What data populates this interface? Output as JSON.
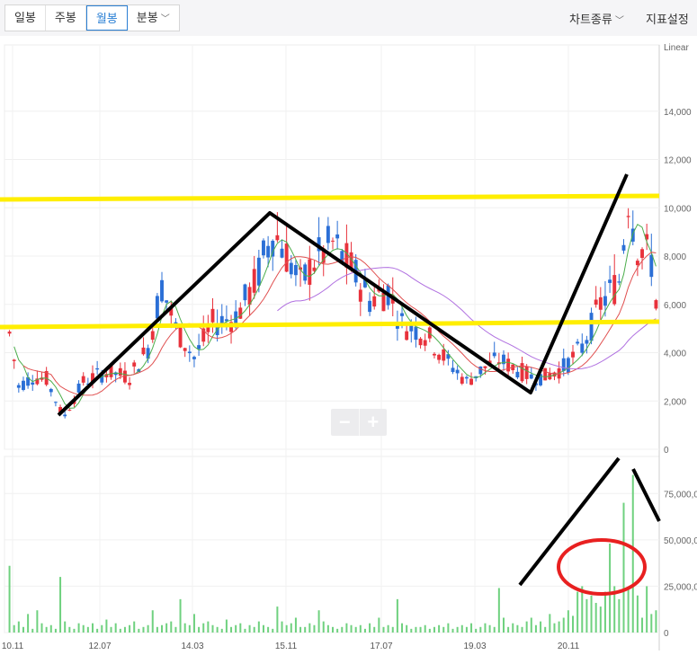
{
  "toolbar": {
    "tabs": [
      {
        "label": "일봉",
        "active": false
      },
      {
        "label": "주봉",
        "active": false
      },
      {
        "label": "월봉",
        "active": true
      },
      {
        "label": "분봉",
        "active": false
      }
    ],
    "chart_type_menu": "차트종류",
    "indicator_menu": "지표설정"
  },
  "zoom": {
    "minus": "−",
    "plus": "+"
  },
  "colors": {
    "up": "#e8323c",
    "down": "#2b6fd6",
    "volume": "#6fd17f",
    "support_line": "#ffee00",
    "annotation": "#000000",
    "circle": "#e82020",
    "ma_short": "#4cae4c",
    "ma_mid": "#e05050",
    "ma_long": "#b070e0"
  },
  "chart_data": {
    "type": "candlestick",
    "scale": "Linear",
    "y_ticks": [
      "14,000",
      "12,000",
      "10,000",
      "8,000",
      "6,000",
      "4,000",
      "2,000",
      "0"
    ],
    "y_range": [
      0,
      16000
    ],
    "volume_ticks": [
      "75,000,0",
      "50,000,0",
      "25,000,0",
      "0"
    ],
    "volume_range": [
      0,
      95000
    ],
    "x_labels": [
      "10.11",
      "12.07",
      "14.03",
      "15.11",
      "17.07",
      "19.03",
      "20.11"
    ],
    "price_anchors": [
      [
        0,
        4800
      ],
      [
        2,
        2600
      ],
      [
        5,
        3000
      ],
      [
        8,
        2900
      ],
      [
        11,
        1600
      ],
      [
        12,
        1400
      ],
      [
        16,
        2800
      ],
      [
        21,
        3200
      ],
      [
        26,
        3000
      ],
      [
        30,
        4200
      ],
      [
        33,
        6800
      ],
      [
        36,
        5000
      ],
      [
        40,
        3800
      ],
      [
        44,
        5200
      ],
      [
        49,
        5500
      ],
      [
        53,
        6800
      ],
      [
        57,
        9000
      ],
      [
        59,
        8500
      ],
      [
        63,
        6800
      ],
      [
        66,
        7800
      ],
      [
        70,
        8500
      ],
      [
        74,
        7500
      ],
      [
        78,
        6200
      ],
      [
        82,
        6600
      ],
      [
        85,
        5200
      ],
      [
        90,
        4800
      ],
      [
        95,
        3600
      ],
      [
        99,
        2800
      ],
      [
        103,
        3400
      ],
      [
        106,
        3700
      ],
      [
        109,
        3400
      ],
      [
        113,
        3000
      ],
      [
        116,
        3000
      ],
      [
        120,
        3400
      ],
      [
        124,
        4200
      ],
      [
        128,
        6000
      ],
      [
        132,
        7000
      ],
      [
        134,
        10500
      ],
      [
        136,
        8500
      ],
      [
        139,
        7800
      ],
      [
        140,
        6200
      ]
    ],
    "volume_values": [
      36,
      4,
      6,
      3,
      10,
      2,
      12,
      5,
      3,
      4,
      2,
      30,
      6,
      3,
      2,
      5,
      4,
      3,
      5,
      2,
      4,
      7,
      3,
      5,
      2,
      3,
      4,
      6,
      2,
      3,
      4,
      12,
      3,
      4,
      5,
      6,
      3,
      18,
      5,
      4,
      10,
      3,
      5,
      6,
      4,
      3,
      2,
      7,
      3,
      4,
      5,
      2,
      4,
      3,
      6,
      4,
      3,
      2,
      14,
      6,
      4,
      5,
      8,
      3,
      3,
      5,
      4,
      12,
      6,
      4,
      3,
      2,
      3,
      5,
      4,
      3,
      4,
      2,
      5,
      3,
      8,
      3,
      4,
      3,
      18,
      5,
      4,
      2,
      3,
      3,
      4,
      2,
      3,
      4,
      3,
      5,
      2,
      3,
      4,
      3,
      5,
      2,
      3,
      5,
      4,
      3,
      24,
      8,
      3,
      5,
      4,
      3,
      6,
      8,
      4,
      6,
      3,
      10,
      5,
      6,
      8,
      12,
      9,
      22,
      25,
      18,
      20,
      16,
      14,
      22,
      48,
      25,
      18,
      70,
      24,
      85,
      20,
      8,
      25,
      10,
      12
    ],
    "support_lines": [
      "10000",
      "5000"
    ]
  }
}
